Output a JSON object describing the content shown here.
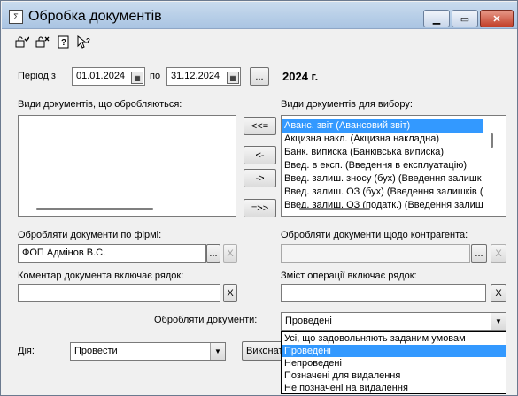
{
  "window": {
    "title": "Обробка документів",
    "controls": {
      "minimize": "▁",
      "maximize": "▭",
      "close": "✕"
    }
  },
  "toolbar": {
    "icons": [
      "select-all-icon",
      "deselect-all-icon",
      "help-icon",
      "context-help-icon"
    ]
  },
  "period": {
    "label_from": "Період з",
    "date_from": "01.01.2024",
    "label_to": "по",
    "date_to": "31.12.2024",
    "picker_label": "...",
    "year_display": "2024 г."
  },
  "processed_types": {
    "label": "Види документів, що обробляються:",
    "items": []
  },
  "transfer_buttons": {
    "add_all": "<<=",
    "add": "<-",
    "remove": "->",
    "remove_all": "=>>"
  },
  "available_types": {
    "label": "Види документів для вибору:",
    "items": [
      "Аванс. звіт (Авансовий звіт)",
      "Акцизна накл. (Акцизна накладна)",
      "Банк. виписка (Банківська виписка)",
      "Введ. в експ. (Введення в експлуатацію)",
      "Введ. залиш. зносу (бух) (Введення залишк",
      "Введ. залиш. ОЗ (бух) (Введення залишків (",
      "Введ. залиш. ОЗ (податк.) (Введення залиш"
    ],
    "selected_index": 0
  },
  "firm": {
    "label": "Обробляти документи по фірмі:",
    "value": "ФОП Адмінов В.С.",
    "picker_label": "...",
    "clear_label": "X"
  },
  "counterparty": {
    "label": "Обробляти документи щодо контрагента:",
    "value": "",
    "picker_label": "...",
    "clear_label": "X"
  },
  "comment": {
    "label": "Коментар документа включає рядок:",
    "value": "",
    "clear_label": "X"
  },
  "operation": {
    "label": "Зміст операції включає рядок:",
    "value": "",
    "clear_label": "X"
  },
  "process_filter": {
    "label": "Обробляти документи:",
    "value": "Проведені",
    "options": [
      "Усі, що задовольняють заданим умовам",
      "Проведені",
      "Непроведені",
      "Позначені для видалення",
      "Не позначені на видалення"
    ],
    "highlighted_index": 1
  },
  "action": {
    "label": "Дія:",
    "value": "Провести",
    "execute_label": "Виконат"
  }
}
